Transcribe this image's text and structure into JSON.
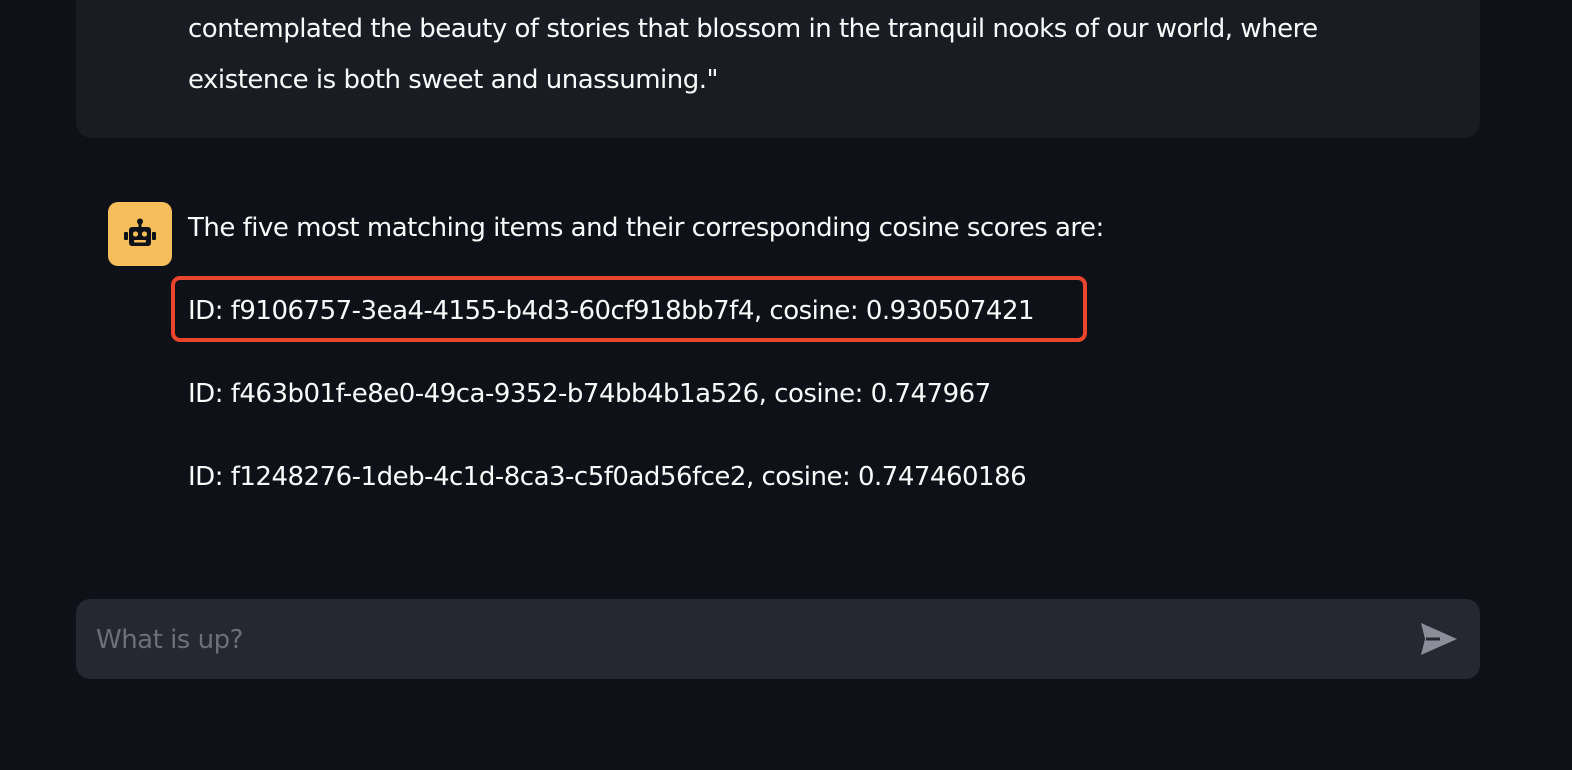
{
  "user_message": {
    "line1": "contemplated the beauty of stories that blossom in the tranquil nooks of our world, where",
    "line2": "existence is both sweet and unassuming.\""
  },
  "assistant": {
    "avatar_icon": "robot-icon",
    "intro": "The five most matching items and their corresponding cosine scores are:",
    "results": [
      "ID: f9106757-3ea4-4155-b4d3-60cf918bb7f4, cosine: 0.930507421",
      "ID: f463b01f-e8e0-49ca-9352-b74bb4b1a526, cosine: 0.747967",
      "ID: f1248276-1deb-4c1d-8ca3-c5f0ad56fce2, cosine: 0.747460186"
    ]
  },
  "chat_input": {
    "placeholder": "What is up?",
    "value": "",
    "send_icon": "send-icon"
  },
  "colors": {
    "background": "#0e1117",
    "message_bg": "#1a1c24",
    "avatar_bg": "#f5be5b",
    "highlight": "#e8452c",
    "input_bg": "#262730"
  }
}
